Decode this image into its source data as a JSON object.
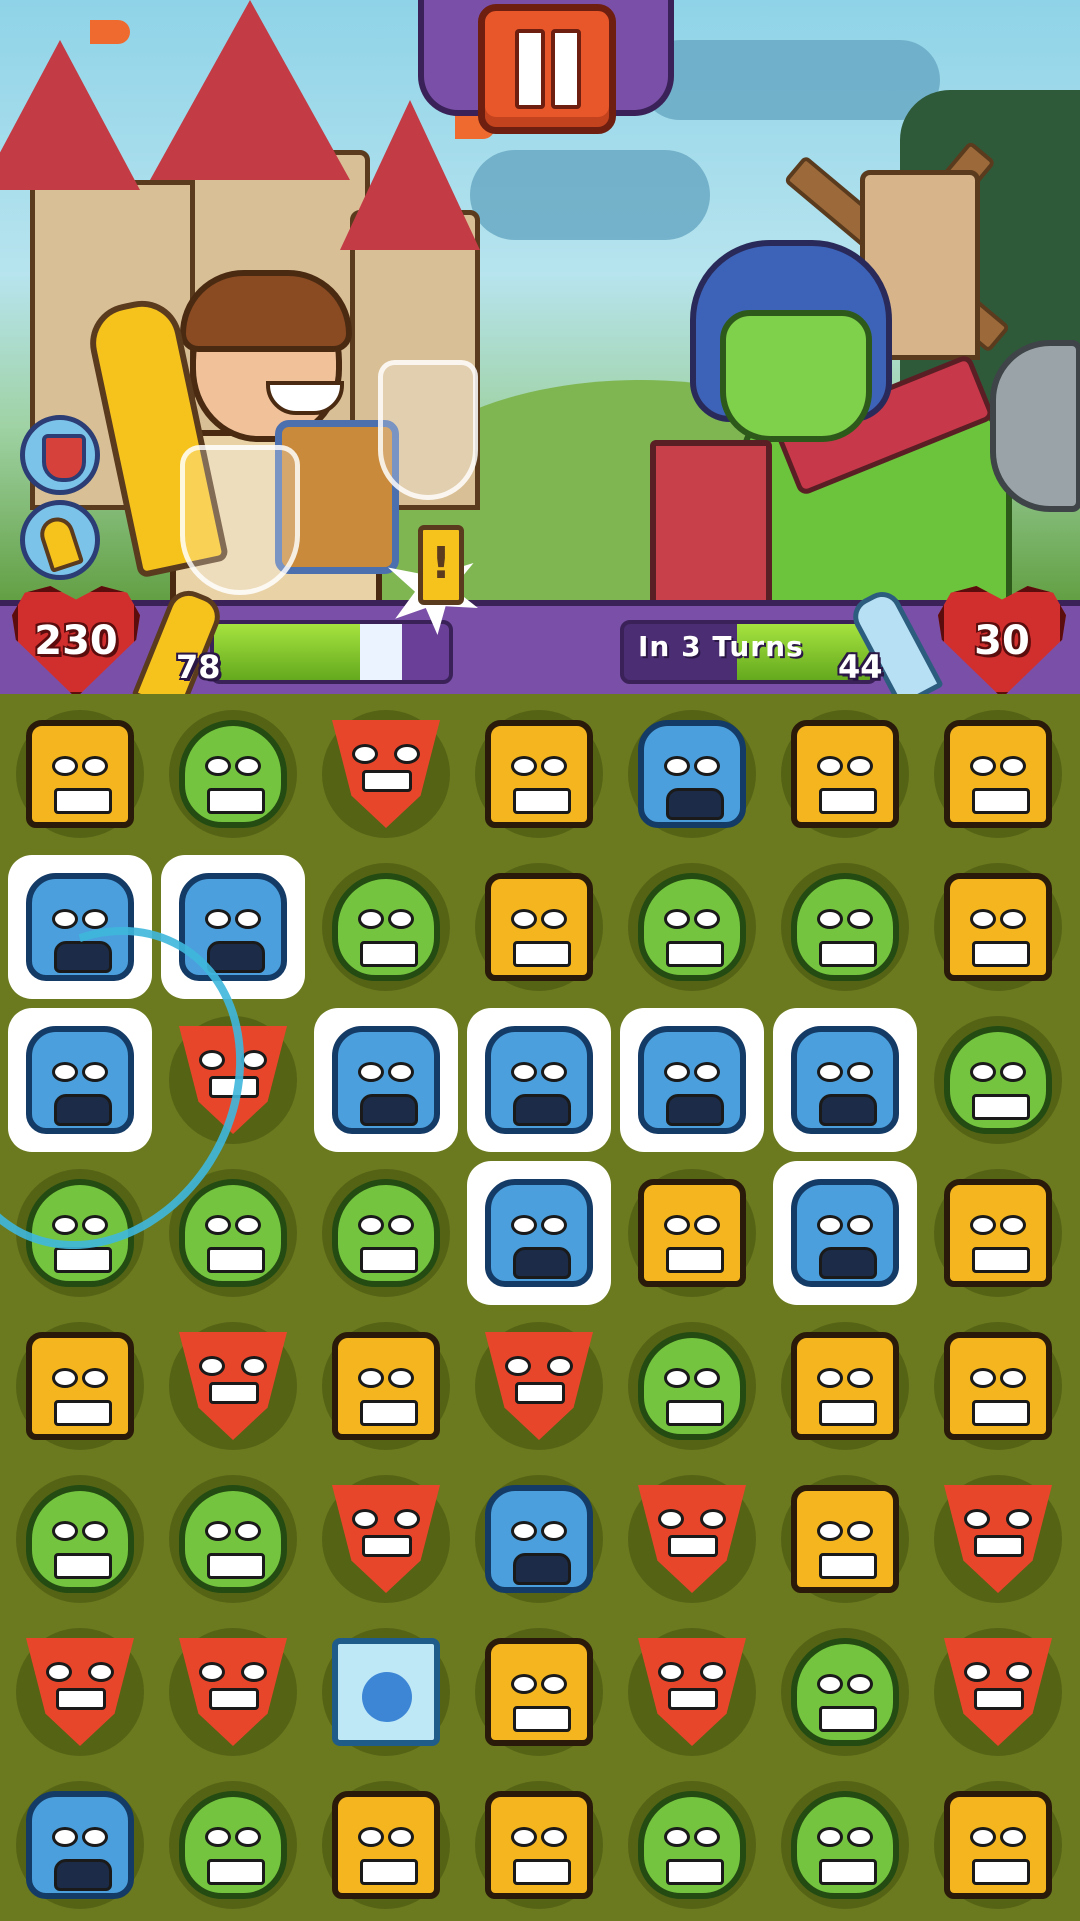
{
  "hud": {
    "player_health": "230",
    "player_attack": "78",
    "enemy_health": "30",
    "enemy_attack": "44",
    "enemy_countdown": "In 3 Turns",
    "player_charge_progress": 0.62,
    "enemy_turn_progress": 0.55
  },
  "pause": {
    "icon": "pause-icon"
  },
  "colors": {
    "yellow": "#f4b51f",
    "green": "#74c43f",
    "red": "#e8462a",
    "blue": "#4b9fdc",
    "board": "#6b7a1e",
    "hud": "#7a4fa8",
    "heart": "#d12e2e"
  },
  "board": {
    "rows": [
      [
        "yellow",
        "green",
        "red",
        "yellow",
        "blue",
        "yellow",
        "yellow"
      ],
      [
        "blue",
        "blue",
        "green",
        "yellow",
        "green",
        "green",
        "yellow"
      ],
      [
        "blue",
        "red",
        "blue",
        "blue",
        "blue",
        "blue",
        "green"
      ],
      [
        "green",
        "green",
        "green",
        "blue",
        "yellow",
        "blue",
        "yellow"
      ],
      [
        "yellow",
        "red",
        "yellow",
        "red",
        "green",
        "yellow",
        "yellow"
      ],
      [
        "green",
        "green",
        "red",
        "blue",
        "red",
        "yellow",
        "red"
      ],
      [
        "red",
        "red",
        "gem",
        "yellow",
        "red",
        "green",
        "red"
      ],
      [
        "blue",
        "green",
        "yellow",
        "yellow",
        "green",
        "green",
        "yellow"
      ]
    ],
    "selected": [
      [
        1,
        0
      ],
      [
        1,
        1
      ],
      [
        2,
        0
      ],
      [
        2,
        2
      ],
      [
        2,
        3
      ],
      [
        2,
        4
      ],
      [
        2,
        5
      ],
      [
        3,
        3
      ],
      [
        3,
        5
      ]
    ]
  }
}
